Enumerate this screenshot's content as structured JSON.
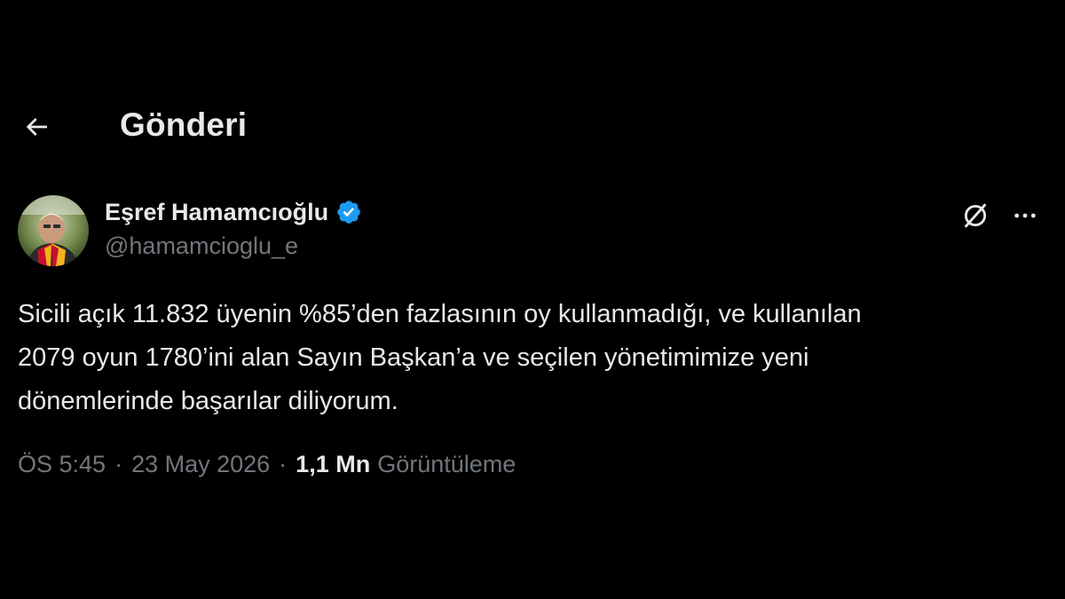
{
  "header": {
    "back_icon": "arrow-left-icon",
    "title": "Gönderi"
  },
  "author": {
    "display_name": "Eşref Hamamcıoğlu",
    "handle": "@hamamcioglu_e",
    "verified": true,
    "verified_color": "#1d9bf0"
  },
  "actions": {
    "grok_icon": "grok-icon",
    "more_icon": "more-horizontal-icon"
  },
  "tweet": {
    "text": "Sicili açık 11.832 üyenin %85’den fazlasının oy kullanmadığı, ve kullanılan\n2079 oyun 1780’ini alan Sayın Başkan’a ve seçilen yönetimimize yeni\ndönemlerinde başarılar diliyorum."
  },
  "meta": {
    "time": "ÖS 5:45",
    "separator": "·",
    "date": "23 May 2026",
    "views_count": "1,1 Mn",
    "views_label": "Görüntüleme"
  },
  "colors": {
    "background": "#000000",
    "text_primary": "#e7e9ea",
    "text_secondary": "#71767b",
    "accent": "#1d9bf0"
  }
}
